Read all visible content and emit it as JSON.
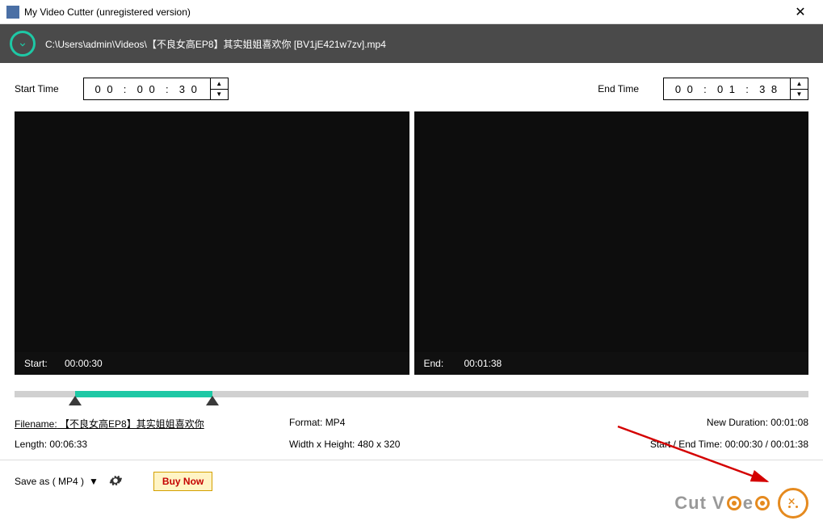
{
  "window": {
    "title": "My Video Cutter (unregistered version)"
  },
  "file": {
    "path": "C:\\Users\\admin\\Videos\\【不良女高EP8】其实姐姐喜欢你 [BV1jE421w7zv].mp4"
  },
  "start": {
    "label": "Start Time",
    "hh": "0 0",
    "mm": "0 0",
    "ss": "3 0",
    "caption_label": "Start:",
    "caption_value": "00:00:30"
  },
  "end": {
    "label": "End Time",
    "hh": "0 0",
    "mm": "0 1",
    "ss": "3 8",
    "caption_label": "End:",
    "caption_value": "00:01:38"
  },
  "timeline": {
    "total_seconds": 393,
    "sel_start_seconds": 30,
    "sel_end_seconds": 98
  },
  "info": {
    "filename_label": "Filename:",
    "filename_value": "【不良女高EP8】其实姐姐喜欢你",
    "format_label": "Format:",
    "format_value": "MP4",
    "new_duration_label": "New Duration:",
    "new_duration_value": "00:01:08",
    "length_label": "Length:",
    "length_value": "00:06:33",
    "dim_label": "Width x Height:",
    "dim_value": "480 x 320",
    "startend_label": "Start / End Time:",
    "startend_value": "00:00:30 / 00:01:38"
  },
  "bottom": {
    "saveas_label": "Save as ( MP4 )",
    "buy_label": "Buy Now"
  },
  "logo": {
    "left": "Cut V",
    "right": "e"
  }
}
